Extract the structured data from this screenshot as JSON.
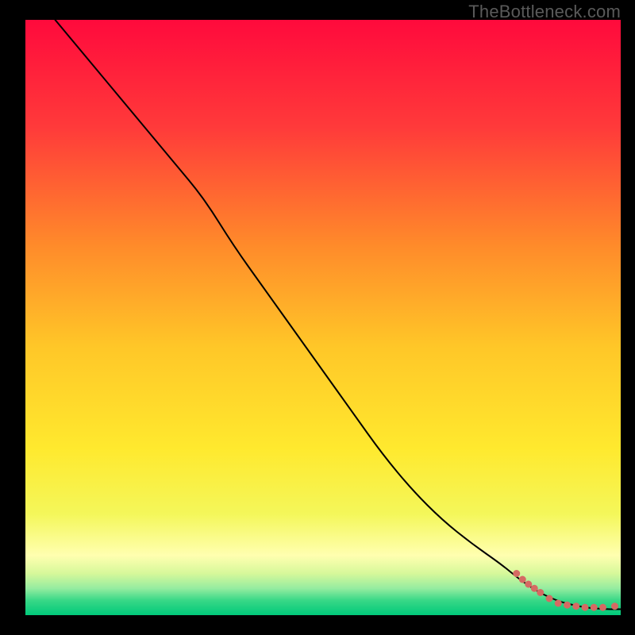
{
  "watermark": "TheBottleneck.com",
  "chart_data": {
    "type": "line",
    "title": "",
    "xlabel": "",
    "ylabel": "",
    "xlim": [
      0,
      100
    ],
    "ylim": [
      0,
      100
    ],
    "grid": false,
    "legend": false,
    "background_gradient": {
      "direction": "vertical",
      "stops": [
        {
          "pos": 0.0,
          "color": "#ff0a3c"
        },
        {
          "pos": 0.18,
          "color": "#ff3a3a"
        },
        {
          "pos": 0.38,
          "color": "#ff8b2a"
        },
        {
          "pos": 0.55,
          "color": "#ffc728"
        },
        {
          "pos": 0.72,
          "color": "#ffe92e"
        },
        {
          "pos": 0.83,
          "color": "#f4f75a"
        },
        {
          "pos": 0.9,
          "color": "#ffffb0"
        },
        {
          "pos": 0.93,
          "color": "#d6f89a"
        },
        {
          "pos": 0.955,
          "color": "#95eca0"
        },
        {
          "pos": 0.975,
          "color": "#39d887"
        },
        {
          "pos": 1.0,
          "color": "#00c97a"
        }
      ]
    },
    "series": [
      {
        "name": "curve",
        "color": "#000000",
        "stroke_width": 2,
        "x": [
          5,
          10,
          15,
          20,
          25,
          30,
          35,
          40,
          45,
          50,
          55,
          60,
          65,
          70,
          75,
          80,
          83,
          86,
          88,
          90,
          92,
          94,
          96,
          98,
          100
        ],
        "y": [
          100,
          94,
          88,
          82,
          76,
          70,
          62,
          55,
          48,
          41,
          34,
          27,
          21,
          16,
          12,
          8.5,
          6,
          4,
          3,
          2.2,
          1.7,
          1.3,
          1.1,
          1.0,
          1.0
        ]
      }
    ],
    "markers": {
      "name": "dashed-tail",
      "color": "#d56a63",
      "radius": 4.5,
      "points": [
        {
          "x": 82.5,
          "y": 7.0
        },
        {
          "x": 83.5,
          "y": 6.0
        },
        {
          "x": 84.5,
          "y": 5.2
        },
        {
          "x": 85.5,
          "y": 4.5
        },
        {
          "x": 86.5,
          "y": 3.8
        },
        {
          "x": 88.0,
          "y": 2.8
        },
        {
          "x": 89.5,
          "y": 2.0
        },
        {
          "x": 91.0,
          "y": 1.7
        },
        {
          "x": 92.5,
          "y": 1.5
        },
        {
          "x": 94.0,
          "y": 1.3
        },
        {
          "x": 95.5,
          "y": 1.3
        },
        {
          "x": 97.0,
          "y": 1.3
        },
        {
          "x": 99.0,
          "y": 1.5
        }
      ]
    }
  }
}
